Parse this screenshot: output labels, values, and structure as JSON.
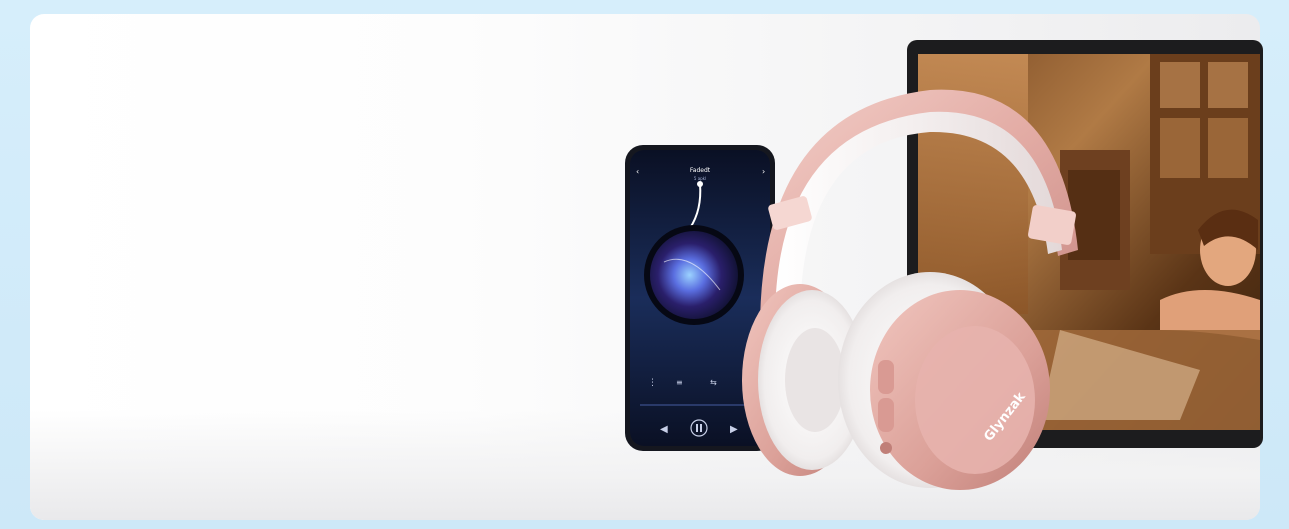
{
  "scene": {
    "headphones_brand_text": "Glynzak"
  },
  "phone": {
    "track_title": "Fadedt",
    "track_sub": "5 apkl"
  },
  "colors": {
    "frame": "#cfe9f8",
    "rose_gold": "#e7b3ad",
    "rose_dark": "#c98a84",
    "cushion": "#f6f4f4",
    "phone_body": "#15171f",
    "screen": "#0d1a3d"
  },
  "icons": [
    "prev-icon",
    "play-pause-icon",
    "next-icon",
    "menu-dots-icon",
    "eq-icon",
    "shuffle-icon",
    "back-icon"
  ]
}
